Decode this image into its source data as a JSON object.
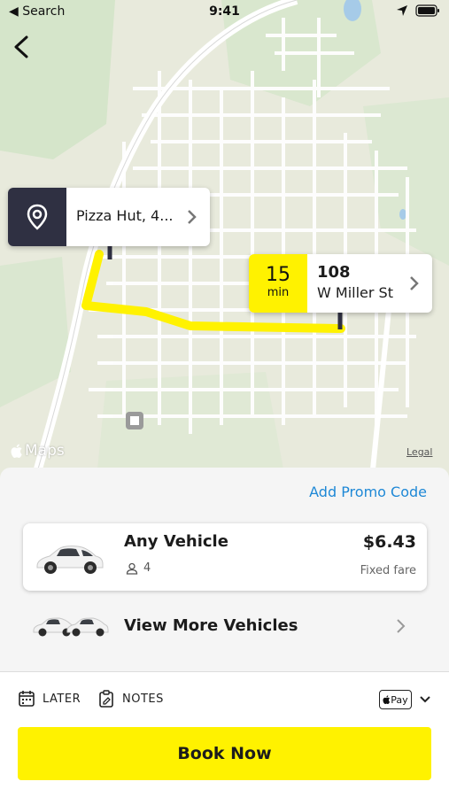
{
  "status_bar": {
    "back_app": "Search",
    "time": "9:41"
  },
  "map": {
    "pickup": {
      "label": "Pizza Hut, 4..."
    },
    "destination": {
      "eta_value": "15",
      "eta_unit": "min",
      "address_line1": "108",
      "address_line2": "W Miller St"
    },
    "attribution": "Maps",
    "legal": "Legal",
    "route_color": "#fff200"
  },
  "sheet": {
    "promo_link": "Add Promo Code",
    "selected_vehicle": {
      "name": "Any Vehicle",
      "seats": "4",
      "price": "$6.43",
      "fare_type": "Fixed fare"
    },
    "more_vehicles": "View More Vehicles"
  },
  "bottom_bar": {
    "later": "LATER",
    "notes": "NOTES",
    "payment_method": "Pay",
    "book_button": "Book Now"
  },
  "colors": {
    "accent": "#fff200",
    "link": "#1e88d6",
    "pin_dark": "#2f3042"
  }
}
